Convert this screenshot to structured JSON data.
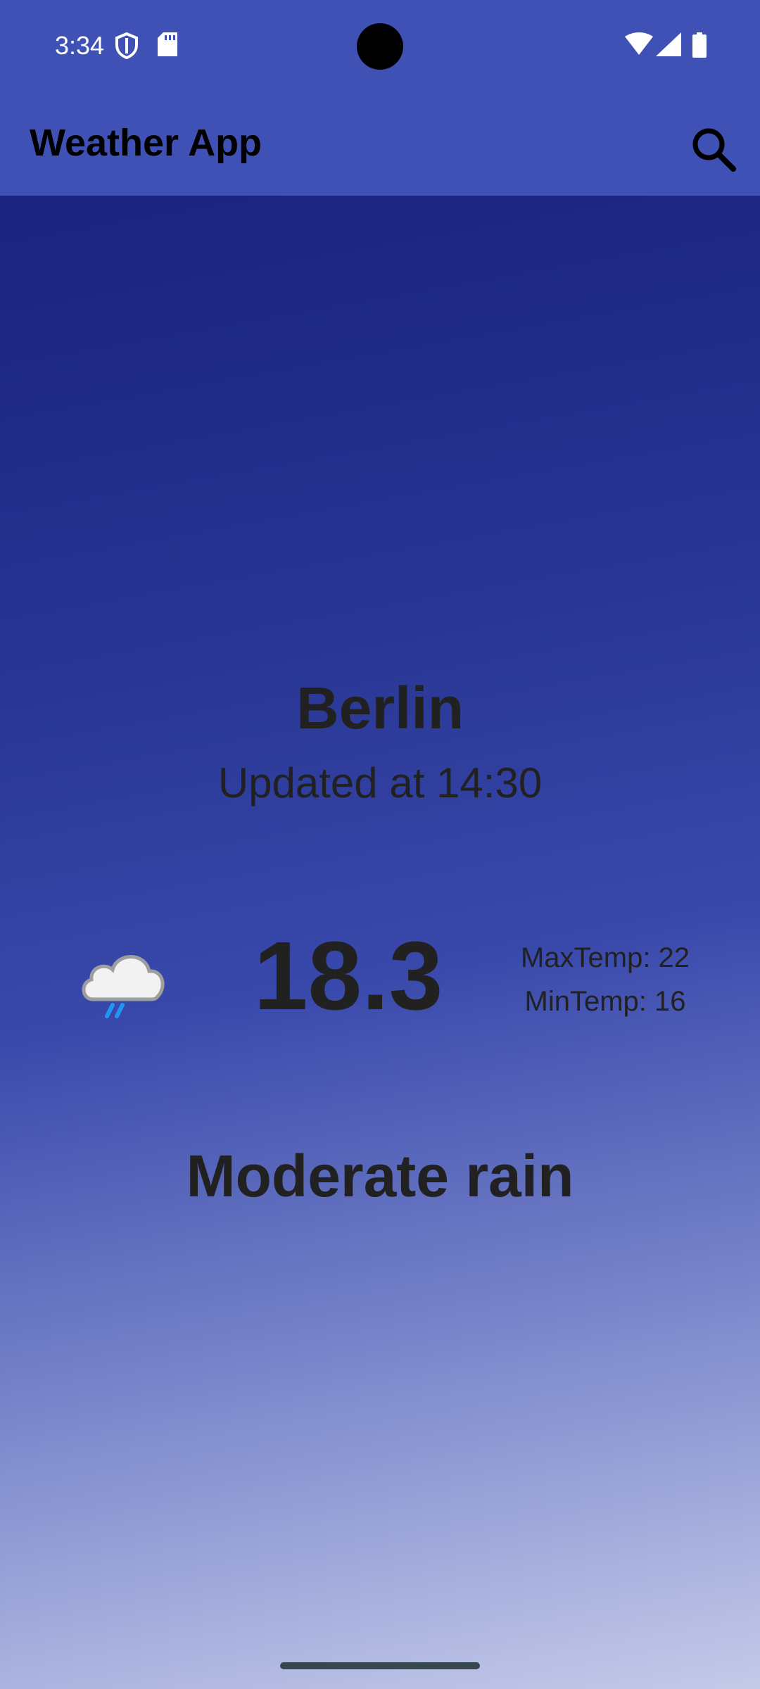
{
  "status_bar": {
    "time": "3:34",
    "icons": [
      "shield-icon",
      "sd-card-icon",
      "wifi-icon",
      "signal-icon",
      "battery-icon"
    ]
  },
  "app_bar": {
    "title": "Weather App",
    "search_icon": "search-icon"
  },
  "weather": {
    "city": "Berlin",
    "updated": "Updated at 14:30",
    "temperature": "18.3",
    "max_temp": "MaxTemp: 22",
    "min_temp": "MinTemp: 16",
    "condition": "Moderate rain",
    "condition_icon": "cloud-rain-icon"
  },
  "colors": {
    "app_bar": "#3f51b5",
    "gradient_top": "#1a237e",
    "gradient_bottom": "#c5cae9",
    "text": "#212121"
  }
}
